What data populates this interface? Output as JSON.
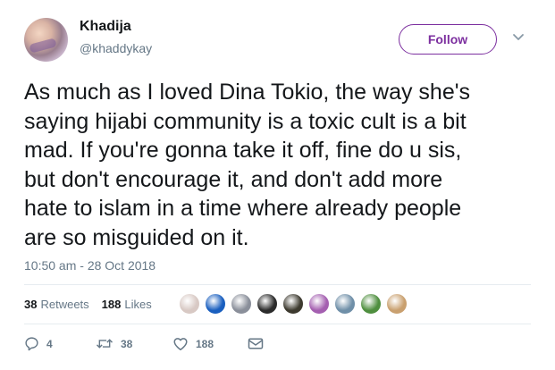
{
  "user": {
    "name": "Khadija",
    "handle": "@khaddykay"
  },
  "follow_label": "Follow",
  "tweet": {
    "lines": [
      "As much as I loved Dina Tokio, the way she's",
      "saying hijabi community is a toxic cult is a bit",
      "mad. If you're gonna take it off, fine do u sis,",
      "but don't encourage it, and don't add more",
      "hate to islam in a time where already people",
      "are so misguided on it."
    ],
    "timestamp": "10:50 am - 28 Oct 2018"
  },
  "stats": {
    "retweets_count": "38",
    "retweets_label": "Retweets",
    "likes_count": "188",
    "likes_label": "Likes"
  },
  "likers": [
    {
      "icon": "liker-avatar",
      "color": "#d8c9c4"
    },
    {
      "icon": "liker-avatar",
      "color": "#1a5fbf"
    },
    {
      "icon": "liker-avatar",
      "color": "#8a8f9a"
    },
    {
      "icon": "liker-avatar",
      "color": "#2b2b2b"
    },
    {
      "icon": "liker-avatar",
      "color": "#3d3a2f"
    },
    {
      "icon": "liker-avatar",
      "color": "#a45fb0"
    },
    {
      "icon": "liker-avatar",
      "color": "#6f8fa8"
    },
    {
      "icon": "liker-avatar",
      "color": "#4f8f3f"
    },
    {
      "icon": "liker-avatar",
      "color": "#c9a06f"
    }
  ],
  "actions": {
    "reply_count": "4",
    "retweet_count": "38",
    "like_count": "188"
  },
  "colors": {
    "follow_accent": "#7c2f9f",
    "secondary_text": "#657786",
    "divider": "#e6ecf0"
  }
}
